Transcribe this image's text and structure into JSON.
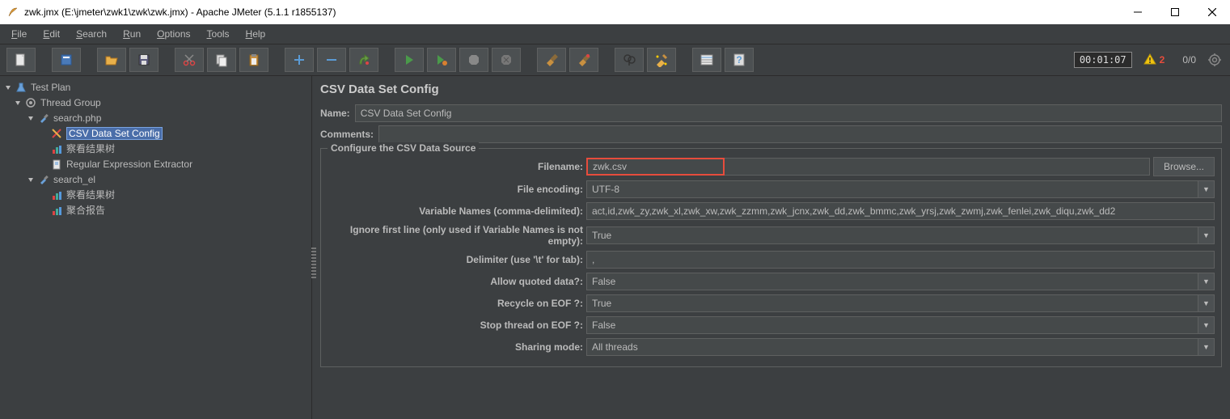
{
  "window": {
    "title": "zwk.jmx (E:\\jmeter\\zwk1\\zwk\\zwk.jmx) - Apache JMeter (5.1.1 r1855137)"
  },
  "menu": {
    "file": "File",
    "edit": "Edit",
    "search": "Search",
    "run": "Run",
    "options": "Options",
    "tools": "Tools",
    "help": "Help"
  },
  "toolbar": {
    "timer": "00:01:07",
    "warn_count": "2",
    "ratio": "0/0"
  },
  "tree": {
    "test_plan": "Test Plan",
    "thread_group": "Thread Group",
    "search_php": "search.php",
    "csv_config": "CSV Data Set Config",
    "view_results_tree_1": "察看结果树",
    "regex_extractor": "Regular Expression Extractor",
    "search_el": "search_el",
    "view_results_tree_2": "察看结果树",
    "aggregate_report": "聚合报告"
  },
  "panel": {
    "title": "CSV Data Set Config",
    "name_label": "Name:",
    "name_value": "CSV Data Set Config",
    "comments_label": "Comments:",
    "legend": "Configure the CSV Data Source",
    "labels": {
      "filename": "Filename:",
      "file_encoding": "File encoding:",
      "variable_names": "Variable Names (comma-delimited):",
      "ignore_first": "Ignore first line (only used if Variable Names is not empty):",
      "delimiter": "Delimiter (use '\\t' for tab):",
      "allow_quoted": "Allow quoted data?:",
      "recycle_eof": "Recycle on EOF ?:",
      "stop_eof": "Stop thread on EOF ?:",
      "sharing_mode": "Sharing mode:"
    },
    "values": {
      "filename": "zwk.csv",
      "file_encoding": "UTF-8",
      "variable_names": "act,id,zwk_zy,zwk_xl,zwk_xw,zwk_zzmm,zwk_jcnx,zwk_dd,zwk_bmmc,zwk_yrsj,zwk_zwmj,zwk_fenlei,zwk_diqu,zwk_dd2",
      "ignore_first": "True",
      "delimiter": ",",
      "allow_quoted": "False",
      "recycle_eof": "True",
      "stop_eof": "False",
      "sharing_mode": "All threads"
    },
    "browse": "Browse..."
  }
}
